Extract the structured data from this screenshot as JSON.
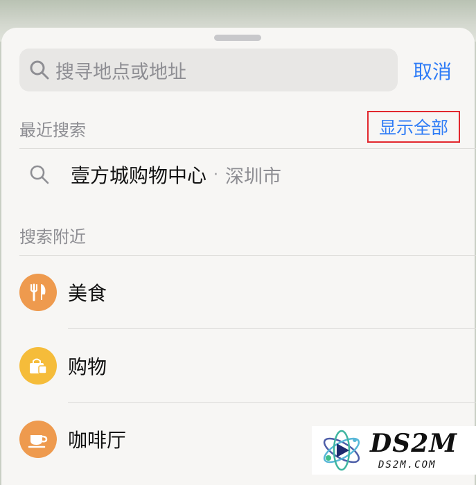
{
  "search": {
    "placeholder": "搜寻地点或地址",
    "cancel_label": "取消"
  },
  "recent": {
    "header": "最近搜索",
    "show_all_label": "显示全部",
    "items": [
      {
        "title": "壹方城购物中心",
        "separator": "·",
        "city": "深圳市"
      }
    ]
  },
  "nearby": {
    "header": "搜索附近",
    "categories": [
      {
        "label": "美食",
        "icon": "fork-knife-icon",
        "color": "#ee9a4e"
      },
      {
        "label": "购物",
        "icon": "shopping-bag-icon",
        "color": "#f5bc3a"
      },
      {
        "label": "咖啡厅",
        "icon": "coffee-cup-icon",
        "color": "#ee9a4e"
      }
    ]
  },
  "watermark": {
    "main": "DS2M",
    "sub": "DS2M.COM"
  },
  "colors": {
    "accent": "#2f7cf6",
    "highlight_border": "#e2272d",
    "secondary_text": "#8e8e93"
  }
}
